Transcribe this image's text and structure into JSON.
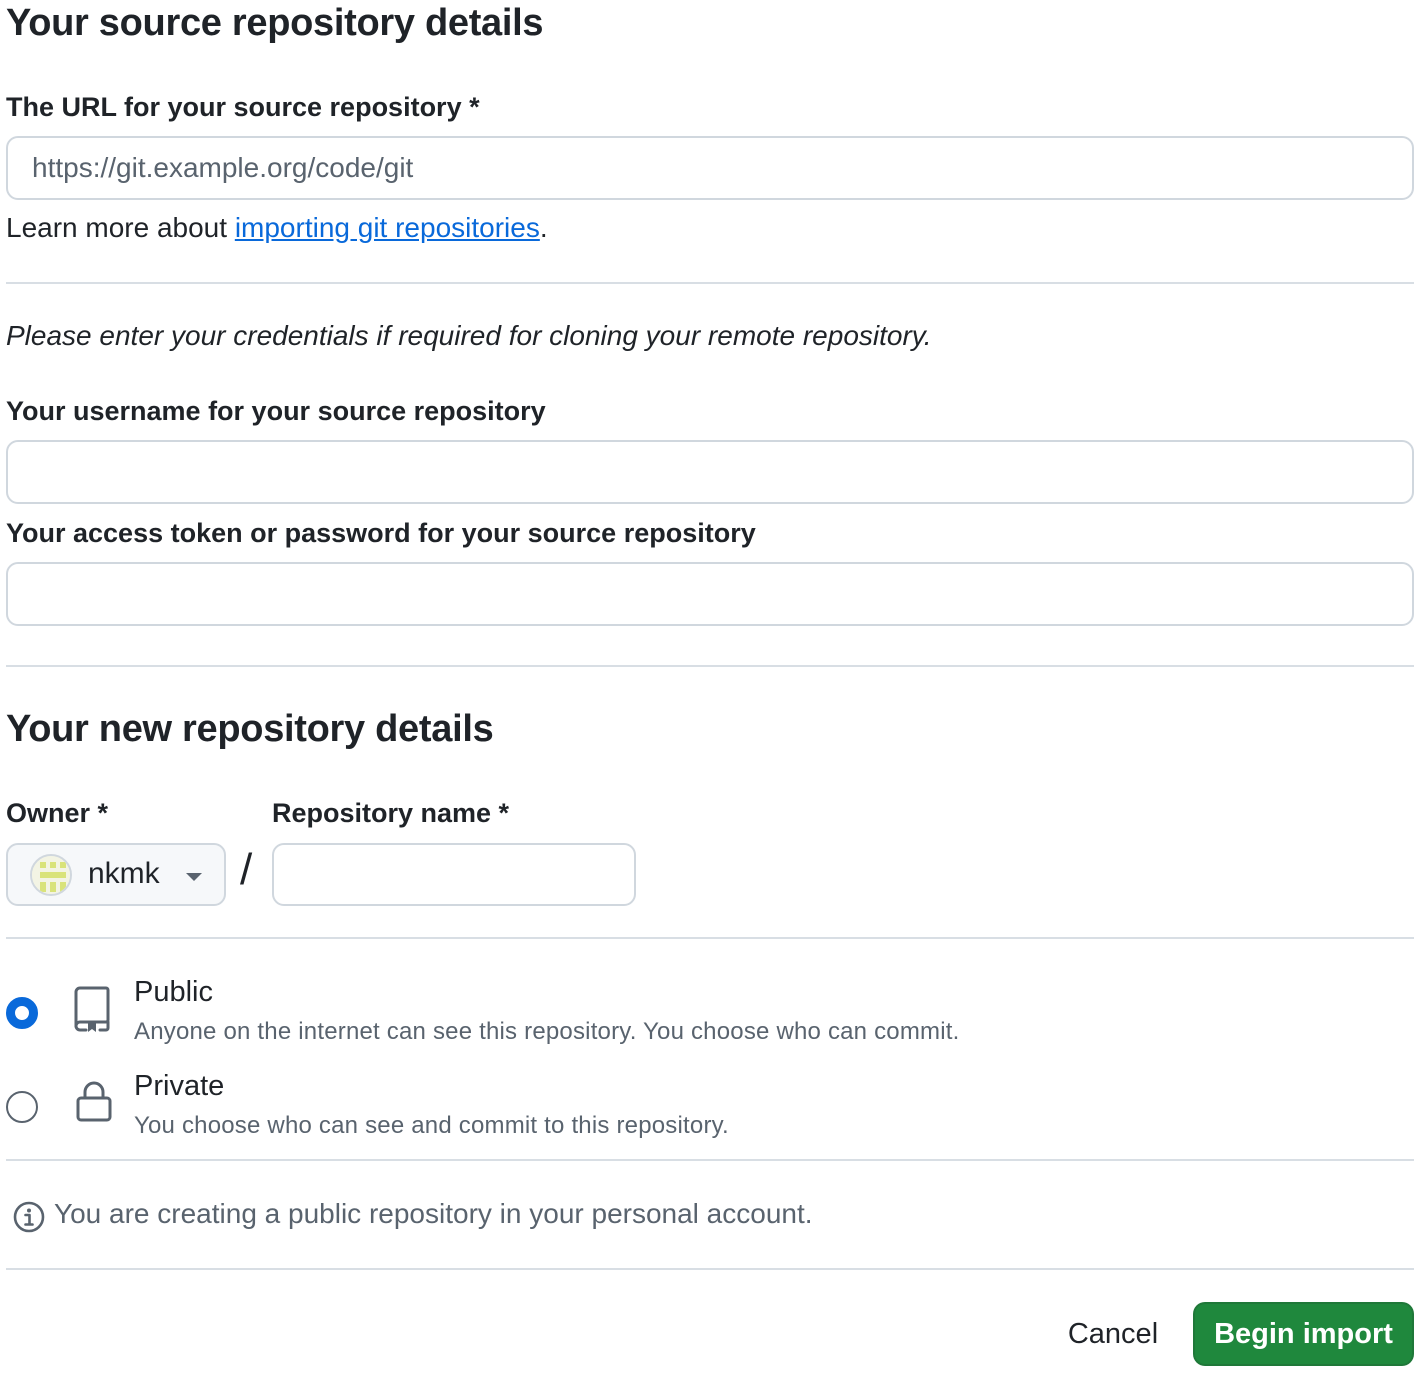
{
  "source": {
    "heading": "Your source repository details",
    "url_label": "The URL for your source repository *",
    "url_placeholder": "https://git.example.org/code/git",
    "learn_prefix": "Learn more about ",
    "learn_link": "importing git repositories",
    "learn_suffix": ".",
    "credentials_note": "Please enter your credentials if required for cloning your remote repository.",
    "username_label": "Your username for your source repository",
    "username_value": "",
    "password_label": "Your access token or password for your source repository",
    "password_value": ""
  },
  "new_repo": {
    "heading": "Your new repository details",
    "owner_label": "Owner *",
    "owner_value": "nkmk",
    "name_label": "Repository name *",
    "name_value": "",
    "separator": "/"
  },
  "visibility": {
    "options": [
      {
        "title": "Public",
        "description": "Anyone on the internet can see this repository. You choose who can commit.",
        "icon": "repo-icon",
        "selected": true
      },
      {
        "title": "Private",
        "description": "You choose who can see and commit to this repository.",
        "icon": "lock-icon",
        "selected": false
      }
    ]
  },
  "info": {
    "icon": "info-icon",
    "text": "You are creating a public repository in your personal account."
  },
  "actions": {
    "cancel_label": "Cancel",
    "submit_label": "Begin import"
  },
  "colors": {
    "primary_button": "#1f883d",
    "link": "#0969da",
    "radio_selected": "#0969da",
    "border": "#d0d7de",
    "muted_text": "#59636e"
  }
}
